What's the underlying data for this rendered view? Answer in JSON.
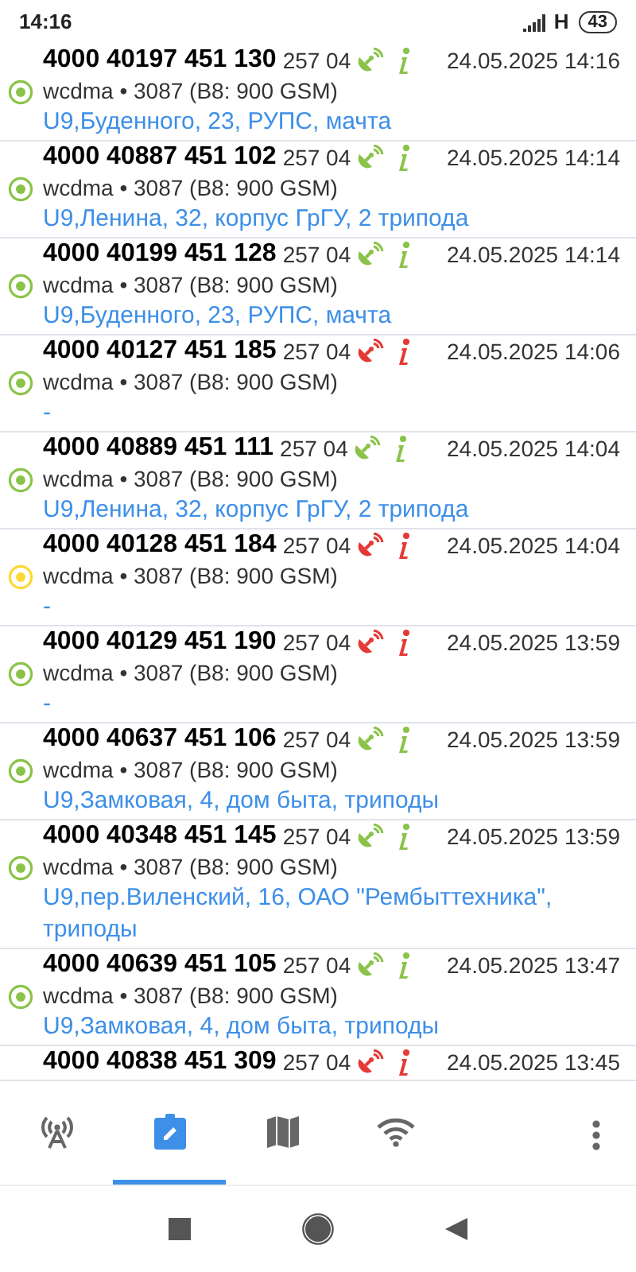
{
  "status_bar": {
    "time": "14:16",
    "network": "H",
    "battery": "43"
  },
  "cells": [
    {
      "number": "4000 40197 451 130",
      "mcc": "257 04",
      "known": true,
      "date": "24.05.2025 14:16",
      "color": "#8bc34a",
      "tech": "wcdma • 3087 (B8: 900 GSM)",
      "address": "U9,Буденного, 23, РУПС, мачта"
    },
    {
      "number": "4000 40887 451 102",
      "mcc": "257 04",
      "known": true,
      "date": "24.05.2025 14:14",
      "color": "#8bc34a",
      "tech": "wcdma • 3087 (B8: 900 GSM)",
      "address": "U9,Ленина, 32, корпус ГрГУ, 2 трипода"
    },
    {
      "number": "4000 40199 451 128",
      "mcc": "257 04",
      "known": true,
      "date": "24.05.2025 14:14",
      "color": "#8bc34a",
      "tech": "wcdma • 3087 (B8: 900 GSM)",
      "address": "U9,Буденного, 23, РУПС, мачта"
    },
    {
      "number": "4000 40127 451 185",
      "mcc": "257 04",
      "known": false,
      "date": "24.05.2025 14:06",
      "color": "#8bc34a",
      "tech": "wcdma • 3087 (B8: 900 GSM)",
      "address": "-"
    },
    {
      "number": "4000 40889 451 111",
      "mcc": "257 04",
      "known": true,
      "date": "24.05.2025 14:04",
      "color": "#8bc34a",
      "tech": "wcdma • 3087 (B8: 900 GSM)",
      "address": "U9,Ленина, 32, корпус ГрГУ, 2 трипода"
    },
    {
      "number": "4000 40128 451 184",
      "mcc": "257 04",
      "known": false,
      "date": "24.05.2025 14:04",
      "color": "#fdd835",
      "tech": "wcdma • 3087 (B8: 900 GSM)",
      "address": "-"
    },
    {
      "number": "4000 40129 451 190",
      "mcc": "257 04",
      "known": false,
      "date": "24.05.2025 13:59",
      "color": "#8bc34a",
      "tech": "wcdma • 3087 (B8: 900 GSM)",
      "address": "-"
    },
    {
      "number": "4000 40637 451 106",
      "mcc": "257 04",
      "known": true,
      "date": "24.05.2025 13:59",
      "color": "#8bc34a",
      "tech": "wcdma • 3087 (B8: 900 GSM)",
      "address": "U9,Замковая, 4, дом быта, триподы"
    },
    {
      "number": "4000 40348 451 145",
      "mcc": "257 04",
      "known": true,
      "date": "24.05.2025 13:59",
      "color": "#8bc34a",
      "tech": "wcdma • 3087 (B8: 900 GSM)",
      "address": "U9,пер.Виленский, 16, ОАО \"Рембыттехника\", триподы"
    },
    {
      "number": "4000 40639 451 105",
      "mcc": "257 04",
      "known": true,
      "date": "24.05.2025 13:47",
      "color": "#8bc34a",
      "tech": "wcdma • 3087 (B8: 900 GSM)",
      "address": "U9,Замковая, 4, дом быта, триподы"
    },
    {
      "number": "4000 40838 451 309",
      "mcc": "257 04",
      "known": false,
      "date": "24.05.2025 13:45"
    }
  ],
  "tabs": [
    {
      "kind": "antenna",
      "selected": false
    },
    {
      "kind": "log",
      "selected": true
    },
    {
      "kind": "map",
      "selected": false
    },
    {
      "kind": "wifi",
      "selected": false
    }
  ]
}
